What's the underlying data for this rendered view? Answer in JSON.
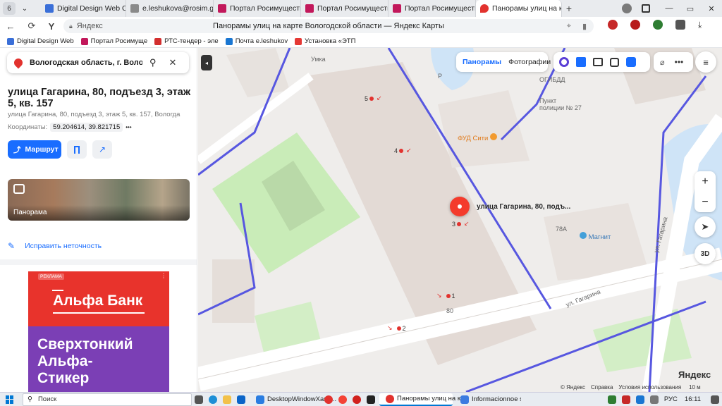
{
  "browser": {
    "tab_counter": "6",
    "tabs": [
      {
        "title": "Digital Design Web Clie",
        "fav": "#3a6fd8"
      },
      {
        "title": "e.leshukova@rosim.gov",
        "fav": "#8a8a8a"
      },
      {
        "title": "Портал Росимущества",
        "fav": "#c2185b"
      },
      {
        "title": "Портал Росимущества",
        "fav": "#c2185b"
      },
      {
        "title": "Портал Росимущества",
        "fav": "#c2185b"
      },
      {
        "title": "Панорамы улиц на к",
        "fav": "#e2322e",
        "active": true
      }
    ],
    "new_tab": "+",
    "address_host": "Яндекс",
    "address_title": "Панорамы улиц на карте Вологодской области — Яндекс Карты",
    "bookmarks": [
      {
        "label": "Digital Design Web",
        "color": "#3a6fd8"
      },
      {
        "label": "Портал Росимуще",
        "color": "#c2185b"
      },
      {
        "label": "РТС-тендер - эле",
        "color": "#d32f2f"
      },
      {
        "label": "Почта e.leshukov",
        "color": "#1976d2"
      },
      {
        "label": "Установка «ЭТП",
        "color": "#e53935"
      }
    ]
  },
  "sidebar": {
    "search_value": "Вологодская область, г. Вологда, ул. I",
    "title": "улица Гагарина, 80, подъезд 3, этаж 5, кв. 157",
    "subtitle": "улица Гагарина, 80, подъезд 3, этаж 5, кв. 157, Вологда",
    "coords_label": "Координаты:",
    "coords_value": "59.204614, 39.821715",
    "coords_more": "•••",
    "route_label": "Маршрут",
    "panorama_label": "Панорама",
    "fix_label": "Исправить неточность",
    "ad": {
      "badge": "РЕКЛАМА",
      "brand": "Альфа Банк",
      "line1": "Сверхтонкий",
      "line2": "Альфа-",
      "line3": "Стикер"
    }
  },
  "map": {
    "tab_panoramas": "Панорамы",
    "tab_photos": "Фотографии",
    "popup_label": "улица Гагарина, 80, подъ...",
    "zoom_in": "+",
    "zoom_out": "−",
    "btn_3d": "3D",
    "labels": {
      "umka": "Умка",
      "gibdd": "ОГИБДД",
      "police": "Пункт полиции № 27",
      "fud": "ФУД Сити",
      "magnit": "Магнит",
      "b78a": "78А",
      "b80": "80",
      "street1": "ул. Гагарина",
      "street2": "ул. Гагарина",
      "p": "P"
    },
    "entrances": [
      "5",
      "4",
      "3",
      "1",
      "2"
    ],
    "logo": "Яндекс",
    "footer_copy": "© Яндекс",
    "footer_help": "Справка",
    "footer_terms": "Условия использования",
    "scale": "10 м"
  },
  "taskbar": {
    "search": "Поиск",
    "apps": [
      "DesktopWindowXaml...",
      "Панорамы улиц на к...",
      "Informacionnoe soob..."
    ],
    "lang": "РУС",
    "time": "16:11"
  }
}
